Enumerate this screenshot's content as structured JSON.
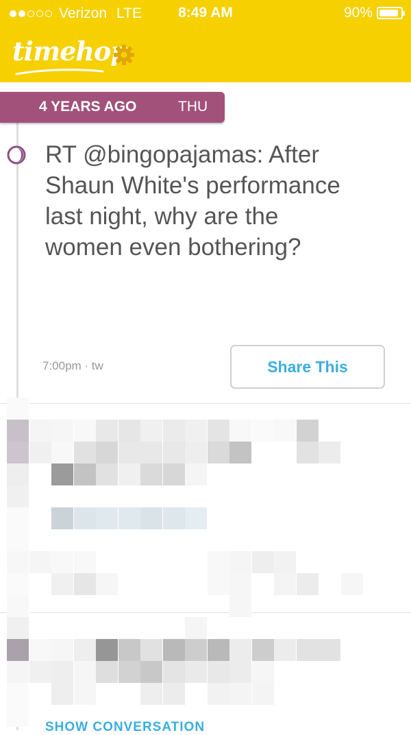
{
  "status_bar": {
    "signal_full": 2,
    "signal_total": 5,
    "carrier": "Verizon",
    "network": "LTE",
    "time": "8:49 AM",
    "battery_text": "90%",
    "battery_level": 0.9
  },
  "header": {
    "logo_text": "timehop",
    "settings_icon": "gear-icon",
    "bg_color": "#f7d000"
  },
  "card": {
    "years_ago": "4 YEARS AGO",
    "day": "THU",
    "badge_color": "#a2517a",
    "time_of_day_icon": "moon-icon",
    "tweet_text": "RT @bingopajamas: After Shaun White's performance last night, why are the women even bothering?",
    "meta": "7:00pm · tw",
    "share_label": "Share This",
    "accent_color": "#3aaee0"
  },
  "next_item": {
    "show_conversation_label": "SHOW CONVERSATION"
  }
}
